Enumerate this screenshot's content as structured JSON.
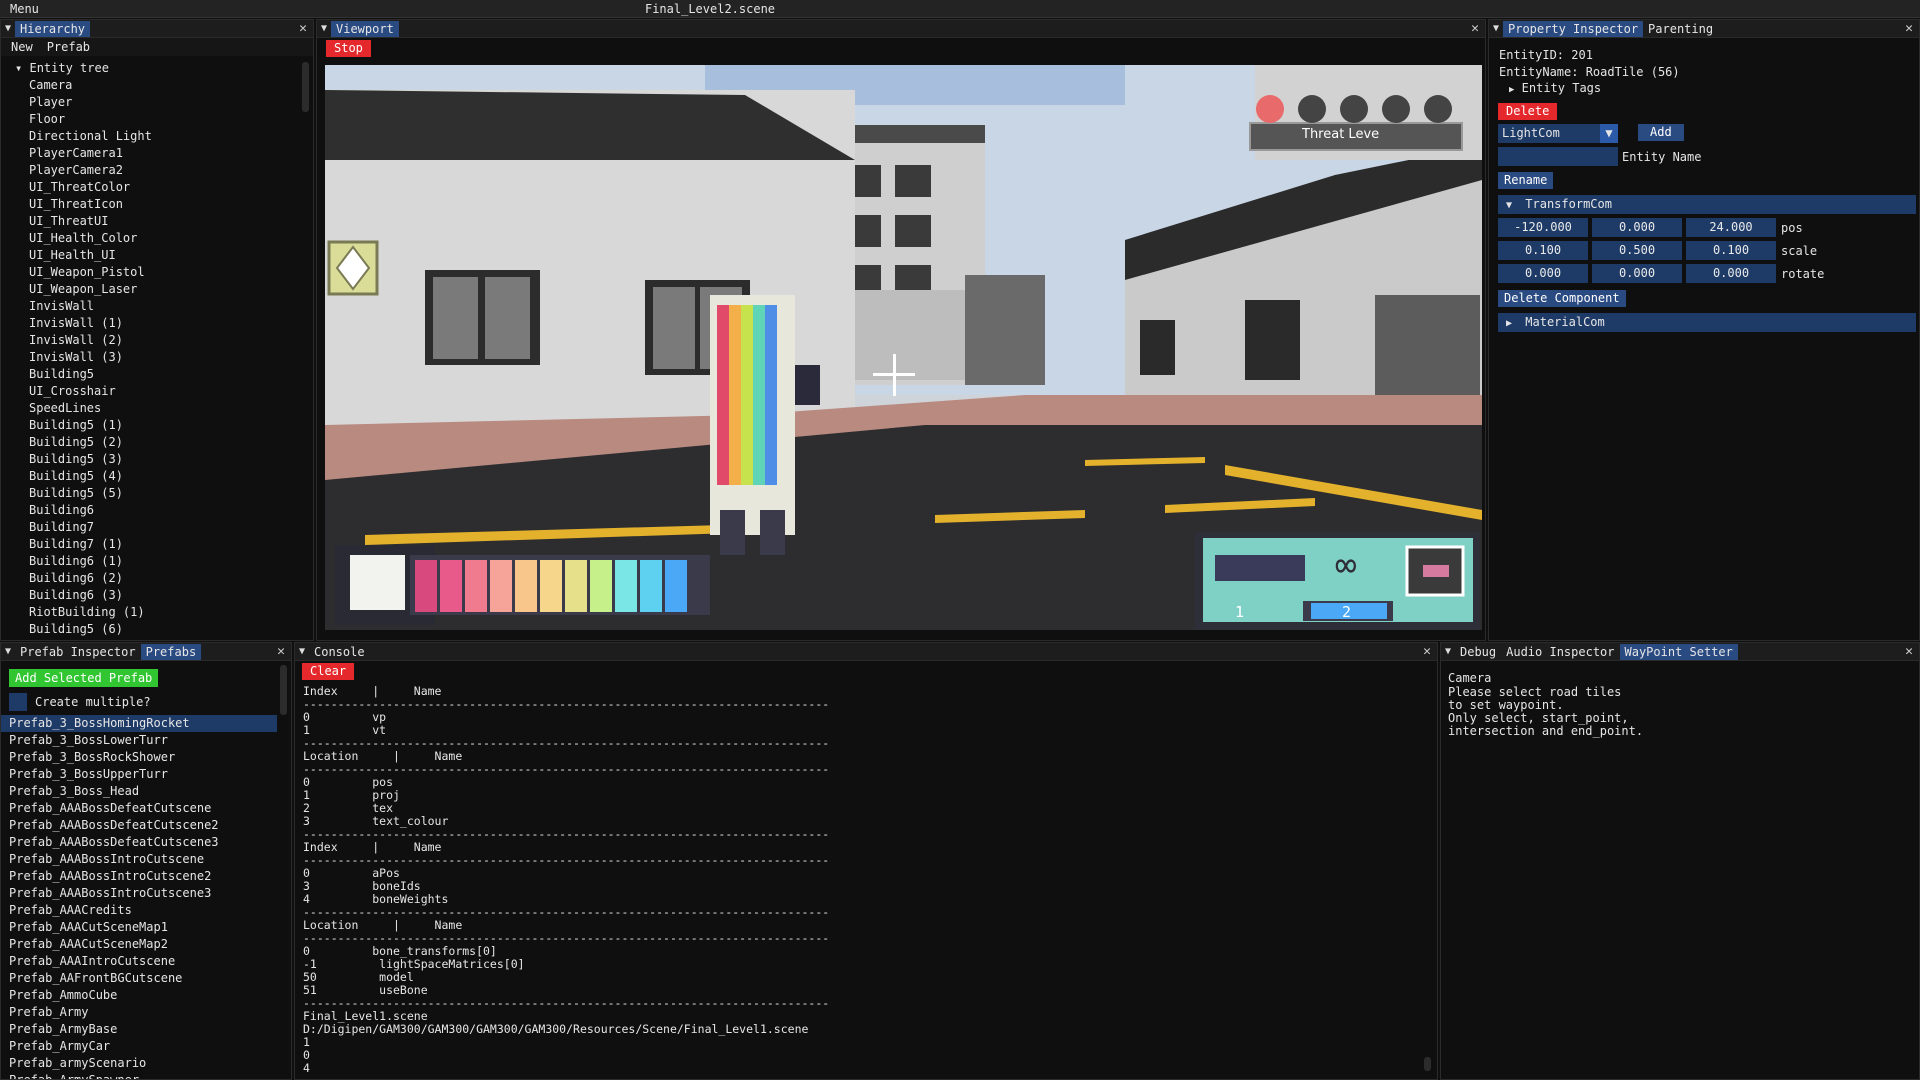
{
  "menubar": {
    "menu": "Menu",
    "title": "Final_Level2.scene"
  },
  "hierarchy": {
    "tab": "Hierarchy",
    "buttons": [
      "New",
      "Prefab"
    ],
    "root": "Entity tree",
    "items": [
      "Camera",
      "Player",
      "Floor",
      "Directional Light",
      "PlayerCamera1",
      "PlayerCamera2",
      "UI_ThreatColor",
      "UI_ThreatIcon",
      "UI_ThreatUI",
      "UI_Health_Color",
      "UI_Health_UI",
      "UI_Weapon_Pistol",
      "UI_Weapon_Laser",
      "InvisWall",
      "InvisWall (1)",
      "InvisWall (2)",
      "InvisWall (3)",
      "Building5",
      "UI_Crosshair",
      "SpeedLines",
      "Building5 (1)",
      "Building5 (2)",
      "Building5 (3)",
      "Building5 (4)",
      "Building5 (5)",
      "Building6",
      "Building7",
      "Building7 (1)",
      "Building6 (1)",
      "Building6 (2)",
      "Building6 (3)",
      "RiotBuilding (1)",
      "Building5 (6)"
    ]
  },
  "viewport": {
    "tab": "Viewport",
    "stop_label": "Stop",
    "hud": {
      "threat_label": "Threat Leve",
      "weapon_slot_1": "1",
      "weapon_slot_2": "2"
    }
  },
  "inspector": {
    "tabs": [
      "Property Inspector",
      "Parenting"
    ],
    "entity_id": "EntityID: 201",
    "entity_name": "EntityName: RoadTile (56)",
    "entity_tags": "Entity Tags",
    "delete_label": "Delete",
    "component_select": "LightCom",
    "add_label": "Add",
    "entity_name_label": "Entity Name",
    "rename_label": "Rename",
    "transform_label": "TransformCom",
    "pos": [
      "-120.000",
      "0.000",
      "24.000"
    ],
    "pos_label": "pos",
    "scale": [
      "0.100",
      "0.500",
      "0.100"
    ],
    "scale_label": "scale",
    "rotate": [
      "0.000",
      "0.000",
      "0.000"
    ],
    "rotate_label": "rotate",
    "delete_component_label": "Delete Component",
    "material_label": "MaterialCom"
  },
  "prefab": {
    "tabs": [
      "Prefab Inspector",
      "Prefabs"
    ],
    "add_selected": "Add Selected Prefab",
    "create_multiple": "Create multiple?",
    "items": [
      "Prefab_3_BossHomingRocket",
      "Prefab_3_BossLowerTurr",
      "Prefab_3_BossRockShower",
      "Prefab_3_BossUpperTurr",
      "Prefab_3_Boss_Head",
      "Prefab_AAABossDefeatCutscene",
      "Prefab_AAABossDefeatCutscene2",
      "Prefab_AAABossDefeatCutscene3",
      "Prefab_AAABossIntroCutscene",
      "Prefab_AAABossIntroCutscene2",
      "Prefab_AAABossIntroCutscene3",
      "Prefab_AAACredits",
      "Prefab_AAACutSceneMap1",
      "Prefab_AAACutSceneMap2",
      "Prefab_AAAIntroCutscene",
      "Prefab_AAFrontBGCutscene",
      "Prefab_AmmoCube",
      "Prefab_Army",
      "Prefab_ArmyBase",
      "Prefab_ArmyCar",
      "Prefab_armyScenario",
      "Prefab_ArmySpawner"
    ]
  },
  "console": {
    "tab": "Console",
    "clear_label": "Clear",
    "text": "Index     |     Name\n----------------------------------------------------------------------------\n0         vp\n1         vt\n----------------------------------------------------------------------------\nLocation     |     Name\n----------------------------------------------------------------------------\n0         pos\n1         proj\n2         tex\n3         text_colour\n----------------------------------------------------------------------------\nIndex     |     Name\n----------------------------------------------------------------------------\n0         aPos\n3         boneIds\n4         boneWeights\n----------------------------------------------------------------------------\nLocation     |     Name\n----------------------------------------------------------------------------\n0         bone_transforms[0]\n-1         lightSpaceMatrices[0]\n50         model\n51         useBone\n----------------------------------------------------------------------------\nFinal_Level1.scene\nD:/Digipen/GAM300/GAM300/GAM300/GAM300/Resources/Scene/Final_Level1.scene\n1\n0\n4"
  },
  "debug": {
    "tabs": [
      "Debug",
      "Audio Inspector",
      "WayPoint Setter"
    ],
    "camera": "Camera",
    "message": "Please select road tiles\nto set waypoint.\nOnly select, start_point,\nintersection and end_point."
  },
  "colors": {
    "accent_blue": "#2a4a82",
    "danger_red": "#e5282b",
    "success_green": "#31c631"
  }
}
